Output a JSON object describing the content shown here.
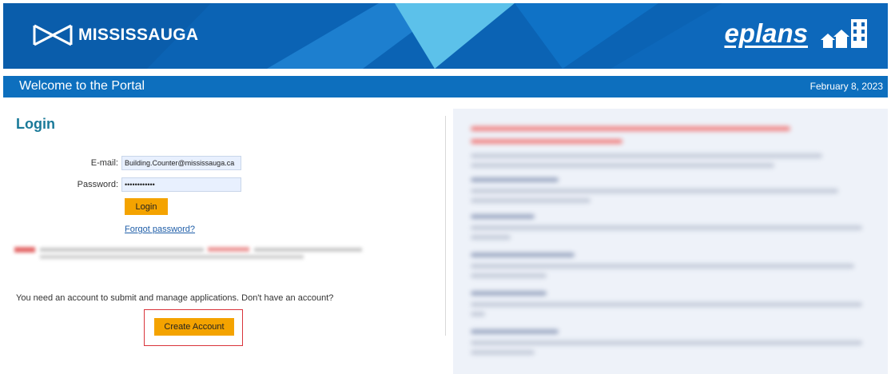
{
  "header": {
    "brand_name": "MISSISSAUGA",
    "product_name": "eplans",
    "colors": {
      "banner_blue": "#0b63b4",
      "light_blue": "#4fb4e6",
      "white": "#ffffff"
    }
  },
  "welcome_bar": {
    "title": "Welcome to the Portal",
    "date": "February 8, 2023"
  },
  "login": {
    "heading": "Login",
    "email_label": "E-mail:",
    "email_value": "Building.Counter@mississauga.ca",
    "password_label": "Password:",
    "password_value": "••••••••••••",
    "login_button": "Login",
    "forgot_password": "Forgot password?"
  },
  "account": {
    "prompt": "You need an account to submit and manage applications. Don't have an account?",
    "create_button": "Create Account"
  },
  "theme": {
    "accent_orange": "#f4a300",
    "heading_teal": "#1a7a99",
    "link_blue": "#1f5ea8",
    "highlight_red": "#d9343b"
  }
}
